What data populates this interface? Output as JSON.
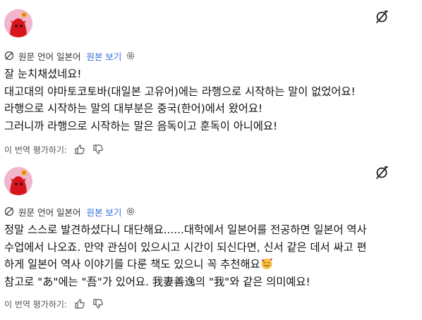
{
  "posts": [
    {
      "meta": {
        "original_language": "원문 언어 일본어",
        "view_original": "원본 보기"
      },
      "lines": [
        "잘 눈치채셨네요!",
        "대고대의 야마토코토바(대일본 고유어)에는 라행으로 시작하는 말이 없었어요!",
        "라행으로 시작하는 말의 대부분은 중국(한어)에서 왔어요!",
        "그러니까 라행으로 시작하는 말은 음독이고 훈독이 아니에요!"
      ],
      "rate_label": "이 번역 평가하기:"
    },
    {
      "meta": {
        "original_language": "원문 언어 일본어",
        "view_original": "원본 보기"
      },
      "lines": [
        "정말 스스로 발견하셨다니 대단해요......대학에서 일본어를 전공하면 일본어 역사",
        "수업에서 나오죠. 만약 관심이 있으시고 시간이 되신다면, 신서 같은 데서 싸고 편",
        "하게 일본어 역사 이야기를 다룬 책도 있으니 꼭 추천해요",
        "참고로 \"あ\"에는 \"吾\"가 있어요. 我妻善逸의 \"我\"와 같은 의미예요!"
      ],
      "emoji": "smiling-face-with-hearts",
      "rate_label": "이 번역 평가하기:"
    }
  ],
  "icons": {
    "avatar": "red-character-avatar",
    "translate": "translate-slash-icon",
    "globe": "globe-icon",
    "settings": "gear-icon",
    "thumbs_up": "thumbs-up-icon",
    "thumbs_down": "thumbs-down-icon"
  },
  "colors": {
    "link": "#2f6fde",
    "avatar_bg": "#f1b6cc",
    "avatar_figure": "#d8151d",
    "text": "#111111",
    "muted": "#555555"
  }
}
